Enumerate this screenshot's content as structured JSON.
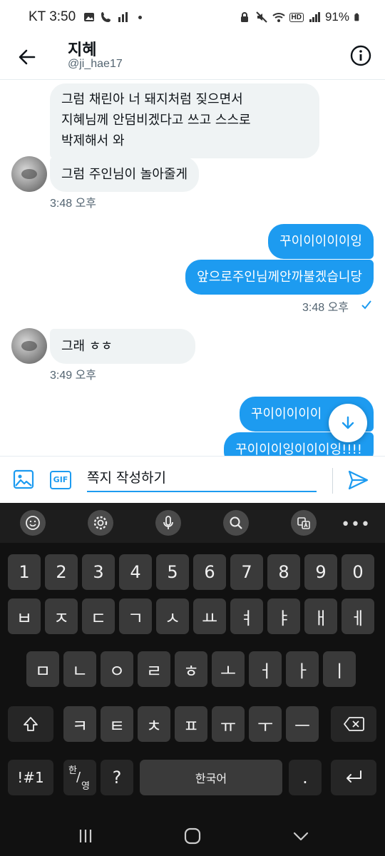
{
  "status_bar": {
    "time": "KT 3:50",
    "battery": "91%",
    "indicator_hd": "HD"
  },
  "header": {
    "name": "지혜",
    "handle": "@ji_hae17"
  },
  "messages": {
    "m1": {
      "line1": "그럼 채린아 너 돼지처럼 짖으면서",
      "line2": "지혜님께 안덤비겠다고 쓰고 스스로",
      "line3": "박제해서 와"
    },
    "m2": "그럼 주인님이 놀아줄게",
    "ts1": "3:48 오후",
    "m3": "꾸이이이이이잉",
    "m4": "앞으로주인님께안까불겠습니당",
    "ts2": "3:48 오후",
    "m5": "그래 ㅎㅎ",
    "ts3": "3:49 오후",
    "m6": "꾸이이이이이",
    "m7": "꾸이이이잉이이이잉!!!!"
  },
  "composer": {
    "gif_label": "GIF",
    "placeholder": "쪽지 작성하기"
  },
  "keyboard": {
    "numbers": [
      "1",
      "2",
      "3",
      "4",
      "5",
      "6",
      "7",
      "8",
      "9",
      "0"
    ],
    "row1": [
      "ㅂ",
      "ㅈ",
      "ㄷ",
      "ㄱ",
      "ㅅ",
      "ㅛ",
      "ㅕ",
      "ㅑ",
      "ㅐ",
      "ㅔ"
    ],
    "row2": [
      "ㅁ",
      "ㄴ",
      "ㅇ",
      "ㄹ",
      "ㅎ",
      "ㅗ",
      "ㅓ",
      "ㅏ",
      "ㅣ"
    ],
    "row3": [
      "ㅋ",
      "ㅌ",
      "ㅊ",
      "ㅍ",
      "ㅠ",
      "ㅜ",
      "ㅡ"
    ],
    "symbols": "!#1",
    "lang_top": "한",
    "lang_bottom": "영",
    "question": "?",
    "space": "한국어",
    "period": "."
  },
  "colors": {
    "accent": "#1d9bf0",
    "incoming_bubble": "#eff3f4",
    "keyboard_bg": "#111111",
    "key_bg": "#3a3a3a"
  },
  "icons": {
    "back": "arrow-left-icon",
    "info": "info-icon",
    "image": "image-icon",
    "gif": "gif-icon",
    "send": "send-icon",
    "scroll_down": "arrow-down-icon"
  }
}
